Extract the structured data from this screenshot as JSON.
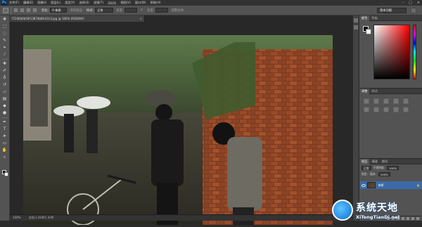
{
  "app": {
    "logo": "Ps"
  },
  "menu": [
    "文件(F)",
    "编辑(E)",
    "图像(I)",
    "图层(L)",
    "类型(Y)",
    "选择(S)",
    "滤镜(T)",
    "3D(D)",
    "视图(V)",
    "窗口(W)",
    "帮助(H)"
  ],
  "window_controls": [
    "–",
    "□",
    "×"
  ],
  "options": {
    "feather_label": "羽化:",
    "feather_value": "0 像素",
    "antialias_label": "消除锯齿",
    "style_label": "样式:",
    "style_value": "正常",
    "width_label": "宽度:",
    "height_label": "高度:",
    "refine_button": "调整边缘...",
    "workspace": "基本功能"
  },
  "document": {
    "tab_title": "f7246b0b50f13874b8fc42c3.jpg @ 100% (RGB/8#)",
    "zoom": "100%",
    "doc_size": "文档:1.41M/1.41M"
  },
  "panels": {
    "color_tabs": [
      "颜色",
      "色板"
    ],
    "adjust_tabs": [
      "调整",
      "样式"
    ],
    "adjust_title": "添加调整",
    "layers_tabs": [
      "图层",
      "通道",
      "路径"
    ],
    "blend_mode": "正常",
    "opacity_label": "不透明度:",
    "opacity_value": "100%",
    "lock_label": "锁定:",
    "fill_label": "填充:",
    "fill_value": "100%",
    "layer_name": "背景"
  },
  "watermark": {
    "cn": "系统天地",
    "en": "XiTongTianDi.net"
  },
  "colors": {
    "foreground": "#000000",
    "background": "#ffffff",
    "selected_layer": "#3c6aa8"
  }
}
